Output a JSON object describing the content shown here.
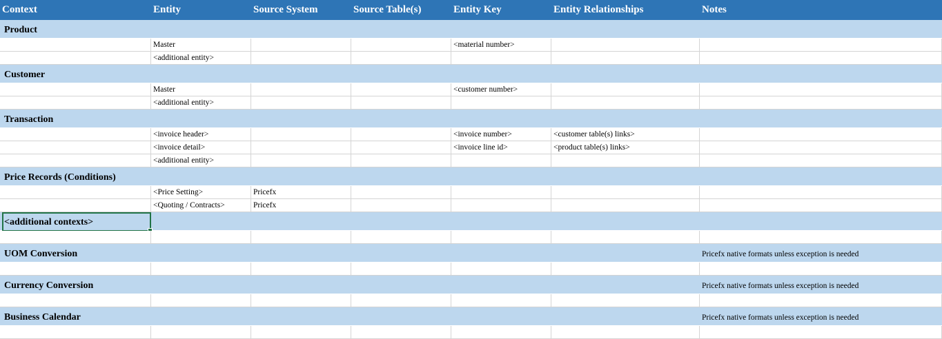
{
  "columns": [
    "Context",
    "Entity",
    "Source System",
    "Source Table(s)",
    "Entity Key",
    "Entity Relationships",
    "Notes"
  ],
  "rows": [
    {
      "kind": "header"
    },
    {
      "kind": "section",
      "context": "Product"
    },
    {
      "kind": "data",
      "cells": [
        "",
        "Master",
        "",
        "",
        "<material number>",
        "",
        ""
      ]
    },
    {
      "kind": "data",
      "cells": [
        "",
        "<additional entity>",
        "",
        "",
        "",
        "",
        ""
      ]
    },
    {
      "kind": "section",
      "context": "Customer"
    },
    {
      "kind": "data",
      "cells": [
        "",
        "Master",
        "",
        "",
        "<customer number>",
        "",
        ""
      ]
    },
    {
      "kind": "data",
      "cells": [
        "",
        "<additional entity>",
        "",
        "",
        "",
        "",
        ""
      ]
    },
    {
      "kind": "section",
      "context": "Transaction"
    },
    {
      "kind": "data",
      "cells": [
        "",
        "<invoice header>",
        "",
        "",
        "<invoice number>",
        "<customer table(s) links>",
        ""
      ]
    },
    {
      "kind": "data",
      "cells": [
        "",
        "<invoice detail>",
        "",
        "",
        "<invoice line id>",
        "<product table(s) links>",
        ""
      ]
    },
    {
      "kind": "data",
      "cells": [
        "",
        "<additional entity>",
        "",
        "",
        "",
        "",
        ""
      ]
    },
    {
      "kind": "section",
      "context": "Price Records (Conditions)"
    },
    {
      "kind": "data",
      "cells": [
        "",
        "<Price Setting>",
        "Pricefx",
        "",
        "",
        "",
        ""
      ]
    },
    {
      "kind": "data",
      "cells": [
        "",
        "<Quoting / Contracts>",
        "Pricefx",
        "",
        "",
        "",
        ""
      ]
    },
    {
      "kind": "section",
      "context": "<additional contexts>",
      "selected": true
    },
    {
      "kind": "data",
      "cells": [
        "",
        "",
        "",
        "",
        "",
        "",
        ""
      ]
    },
    {
      "kind": "section",
      "context": "UOM Conversion",
      "note": "Pricefx native formats unless exception is needed"
    },
    {
      "kind": "data",
      "cells": [
        "",
        "",
        "",
        "",
        "",
        "",
        ""
      ]
    },
    {
      "kind": "section",
      "context": "Currency Conversion",
      "note": "Pricefx native formats unless exception is needed"
    },
    {
      "kind": "data",
      "cells": [
        "",
        "",
        "",
        "",
        "",
        "",
        ""
      ]
    },
    {
      "kind": "section",
      "context": "Business Calendar",
      "note": "Pricefx native formats unless exception is needed"
    },
    {
      "kind": "data",
      "cells": [
        "",
        "",
        "",
        "",
        "",
        "",
        ""
      ]
    }
  ],
  "colors": {
    "header": "#2e75b6",
    "section": "#bdd7ee",
    "gridline": "#d4d4d4",
    "selection": "#217346"
  }
}
